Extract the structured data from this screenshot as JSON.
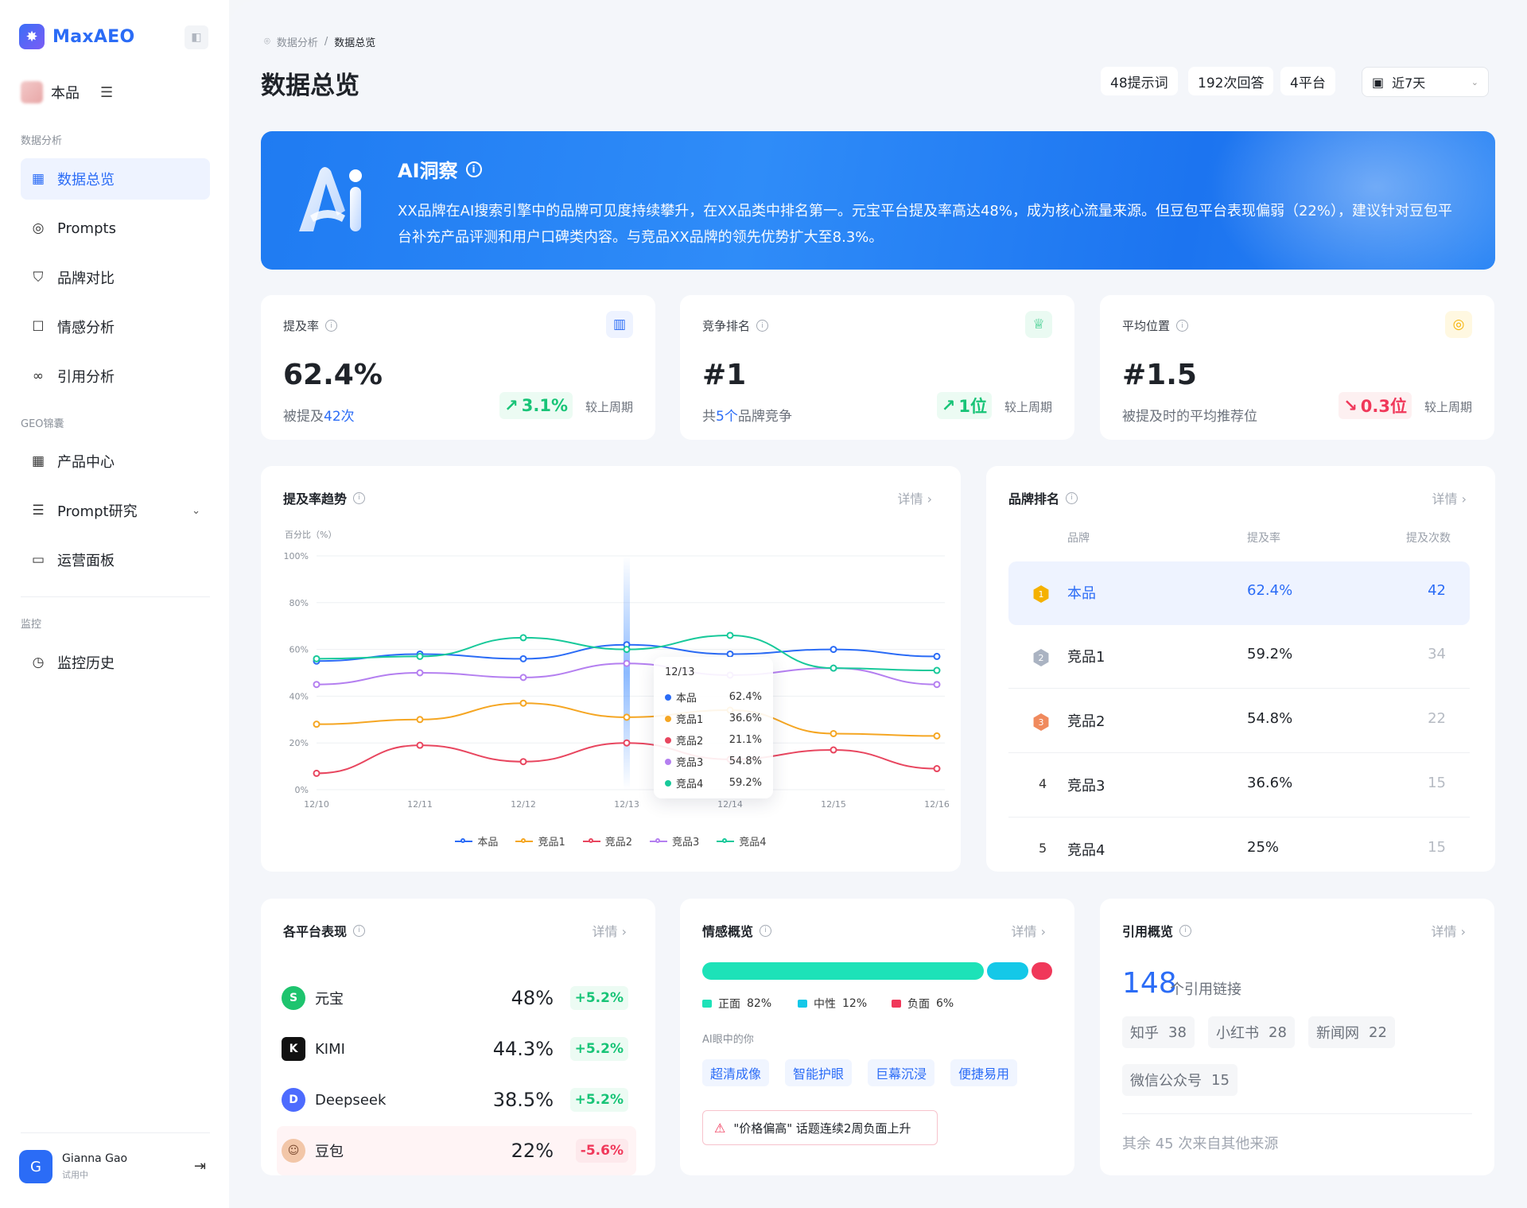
{
  "app": {
    "name": "MaxAEO"
  },
  "product": {
    "name": "本品"
  },
  "sidebar": {
    "group1": "数据分析",
    "items1": [
      {
        "label": "数据总览"
      },
      {
        "label": "Prompts"
      },
      {
        "label": "品牌对比"
      },
      {
        "label": "情感分析"
      },
      {
        "label": "引用分析"
      }
    ],
    "group2": "GEO锦囊",
    "items2": [
      {
        "label": "产品中心"
      },
      {
        "label": "Prompt研究"
      },
      {
        "label": "运营面板"
      }
    ],
    "group3": "监控",
    "items3": [
      {
        "label": "监控历史"
      }
    ]
  },
  "user": {
    "initial": "G",
    "name": "Gianna Gao",
    "status": "试用中"
  },
  "breadcrumb": {
    "parent": "数据分析",
    "sep": "/",
    "current": "数据总览"
  },
  "page": {
    "title": "数据总览"
  },
  "chips": {
    "prompts": "48提示词",
    "answers": "192次回答",
    "platforms": "4平台"
  },
  "date_range": {
    "value": "近7天"
  },
  "ai_insight": {
    "title": "AI洞察",
    "text": "XX品牌在AI搜索引擎中的品牌可见度持续攀升，在XX品类中排名第一。元宝平台提及率高达48%，成为核心流量来源。但豆包平台表现偏弱（22%），建议针对豆包平台补充产品评测和用户口碑类内容。与竞品XX品牌的领先优势扩大至8.3%。"
  },
  "kpis": [
    {
      "title": "提及率",
      "value": "62.4%",
      "sub_pre": "被提及",
      "sub_em": "42次",
      "sub_post": "",
      "delta": "3.1%",
      "dir": "up",
      "compare": "较上周期",
      "icon": "bar-chart-icon",
      "color": "#2b6cf6"
    },
    {
      "title": "竞争排名",
      "value": "#1",
      "sub_pre": "共",
      "sub_em": "5个",
      "sub_post": "品牌竞争",
      "delta": "1位",
      "dir": "up",
      "compare": "较上周期",
      "icon": "trophy-icon",
      "color": "#18c477"
    },
    {
      "title": "平均位置",
      "value": "#1.5",
      "sub_pre": "被提及时的平均推荐位",
      "sub_em": "",
      "sub_post": "",
      "delta": "0.3位",
      "dir": "down",
      "compare": "较上周期",
      "icon": "target-icon",
      "color": "#f5b100"
    }
  ],
  "trend": {
    "title": "提及率趋势",
    "more": "详情",
    "tooltip": {
      "date": "12/13",
      "rows": [
        {
          "name": "本品",
          "value": "62.4%",
          "color": "#2b6cf6"
        },
        {
          "name": "竞品1",
          "value": "36.6%",
          "color": "#f5a623"
        },
        {
          "name": "竞品2",
          "value": "21.1%",
          "color": "#e8465f"
        },
        {
          "name": "竞品3",
          "value": "54.8%",
          "color": "#b47ff0"
        },
        {
          "name": "竞品4",
          "value": "59.2%",
          "color": "#18c99a"
        }
      ]
    }
  },
  "chart_data": {
    "type": "line",
    "ylabel": "百分比（%）",
    "ylim": [
      0,
      100
    ],
    "yticks": [
      "0%",
      "20%",
      "40%",
      "60%",
      "80%",
      "100%"
    ],
    "x": [
      "12/10",
      "12/11",
      "12/12",
      "12/13",
      "12/14",
      "12/15",
      "12/16"
    ],
    "grid": true,
    "legend": "bottom",
    "series": [
      {
        "name": "本品",
        "color": "#2b6cf6",
        "values": [
          55,
          58,
          56,
          62,
          58,
          60,
          57
        ]
      },
      {
        "name": "竞品1",
        "color": "#f5a623",
        "values": [
          28,
          30,
          37,
          31,
          34,
          24,
          23
        ]
      },
      {
        "name": "竞品2",
        "color": "#e8465f",
        "values": [
          7,
          19,
          12,
          20,
          13,
          17,
          9
        ]
      },
      {
        "name": "竞品3",
        "color": "#b47ff0",
        "values": [
          45,
          50,
          48,
          54,
          49,
          52,
          45
        ]
      },
      {
        "name": "竞品4",
        "color": "#18c99a",
        "values": [
          56,
          57,
          65,
          60,
          66,
          52,
          51
        ]
      }
    ]
  },
  "ranking": {
    "title": "品牌排名",
    "more": "详情",
    "headers": {
      "brand": "品牌",
      "rate": "提及率",
      "count": "提及次数"
    },
    "rows": [
      {
        "rank": "1",
        "brand": "本品",
        "rate": "62.4%",
        "count": "42",
        "color": "#f5b100"
      },
      {
        "rank": "2",
        "brand": "竞品1",
        "rate": "59.2%",
        "count": "34",
        "color": "#aab3c2"
      },
      {
        "rank": "3",
        "brand": "竞品2",
        "rate": "54.8%",
        "count": "22",
        "color": "#f08a5d"
      },
      {
        "rank": "4",
        "brand": "竞品3",
        "rate": "36.6%",
        "count": "15",
        "color": ""
      },
      {
        "rank": "5",
        "brand": "竞品4",
        "rate": "25%",
        "count": "15",
        "color": ""
      }
    ]
  },
  "platforms": {
    "title": "各平台表现",
    "more": "详情",
    "rows": [
      {
        "name": "元宝",
        "value": "48%",
        "delta": "+5.2%",
        "dir": "up",
        "color": "#1ec46e",
        "glyph": "S"
      },
      {
        "name": "KIMI",
        "value": "44.3%",
        "delta": "+5.2%",
        "dir": "up",
        "color": "#111111",
        "glyph": "K"
      },
      {
        "name": "Deepseek",
        "value": "38.5%",
        "delta": "+5.2%",
        "dir": "up",
        "color": "#4d6bfe",
        "glyph": "D"
      },
      {
        "name": "豆包",
        "value": "22%",
        "delta": "-5.6%",
        "dir": "dn",
        "color": "#f2c6a8",
        "glyph": "☺"
      }
    ]
  },
  "sentiment": {
    "title": "情感概览",
    "more": "详情",
    "positive": {
      "label": "正面",
      "pct": "82%",
      "value": 82,
      "color": "#1de2b8"
    },
    "neutral": {
      "label": "中性",
      "pct": "12%",
      "value": 12,
      "color": "#14c8e8"
    },
    "negative": {
      "label": "负面",
      "pct": "6%",
      "value": 6,
      "color": "#f0385a"
    },
    "ai_view_label": "AI眼中的你",
    "tags": [
      "超清成像",
      "智能护眼",
      "巨幕沉浸",
      "便捷易用"
    ],
    "warning": "\"价格偏高\" 话题连续2周负面上升"
  },
  "citations": {
    "title": "引用概览",
    "more": "详情",
    "count": "148",
    "unit": "个引用链接",
    "sources": [
      {
        "name": "知乎",
        "n": "38"
      },
      {
        "name": "小红书",
        "n": "28"
      },
      {
        "name": "新闻网",
        "n": "22"
      },
      {
        "name": "微信公众号",
        "n": "15"
      }
    ],
    "other": "其余 45 次来自其他来源"
  }
}
